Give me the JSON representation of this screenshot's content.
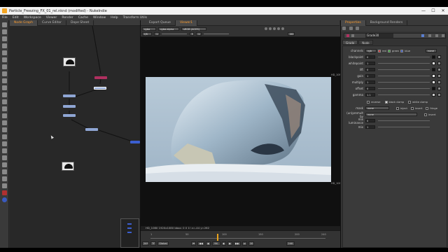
{
  "window": {
    "title": "Particle_Freezing_FX_01_rel.nknd (modified) - NukeIndie",
    "minimize": "—",
    "maximize": "☐",
    "close": "✕"
  },
  "menu": [
    "File",
    "Edit",
    "Workspace",
    "Viewer",
    "Render",
    "Cache",
    "Window",
    "Help",
    "Transform Utils"
  ],
  "nodegraph": {
    "tabs": [
      "Node Graph",
      "Curve Editor",
      "Dope Sheet"
    ]
  },
  "viewer": {
    "tabs": [
      "Export Queue",
      "Viewer1"
    ],
    "channel": "rgba",
    "alpha": "rgba.alpha",
    "colorspace": "sRGB (ACES)",
    "frame_label": "f/8",
    "gain": "1",
    "y_label": "Y",
    "gamma": "1",
    "zoom": "2D",
    "info_text": "HD_1080 1920x1080  bbox: 0 0 1! x=-44 y=262",
    "format_label": "HD_1080",
    "timeline_ticks": [
      "1",
      "50",
      "100",
      "150",
      "200",
      "240"
    ],
    "fps": "24*",
    "tf": "TF",
    "global": "Global",
    "current_frame": "94",
    "end_frame": "240",
    "step": "10"
  },
  "properties": {
    "tabs": [
      "Properties",
      "Background Renders"
    ],
    "node_name": "Grade30",
    "subtabs": [
      "Grade",
      "Node"
    ],
    "channels_label": "channels",
    "channels_value": "rgb",
    "channels_r": "red",
    "channels_g": "green",
    "channels_b": "blue",
    "channels_mode": "none",
    "knobs": [
      {
        "label": "blackpoint",
        "value": "0"
      },
      {
        "label": "whitepoint",
        "value": "1"
      },
      {
        "label": "lift",
        "value": "0"
      },
      {
        "label": "gain",
        "value": "1"
      },
      {
        "label": "multiply",
        "value": "1"
      },
      {
        "label": "offset",
        "value": "0"
      },
      {
        "label": "gamma",
        "value": "1.1"
      }
    ],
    "reverse": "reverse",
    "black_clamp": "black clamp",
    "white_clamp": "white clamp",
    "mask_label": "mask",
    "mask_value": "none",
    "inject": "inject",
    "invert": "invert",
    "fringe": "fringe",
    "unpremult_label": "(un)premult by",
    "unpremult_value": "none",
    "invert2": "invert",
    "mix_lum_label": "mix luminance",
    "mix_lum_value": "0",
    "mix_label": "mix",
    "mix_value": "1"
  },
  "colors": {
    "accent": "#ff9d2e",
    "grade_node": "#b03060",
    "blur_node": "#8fa6d4"
  }
}
